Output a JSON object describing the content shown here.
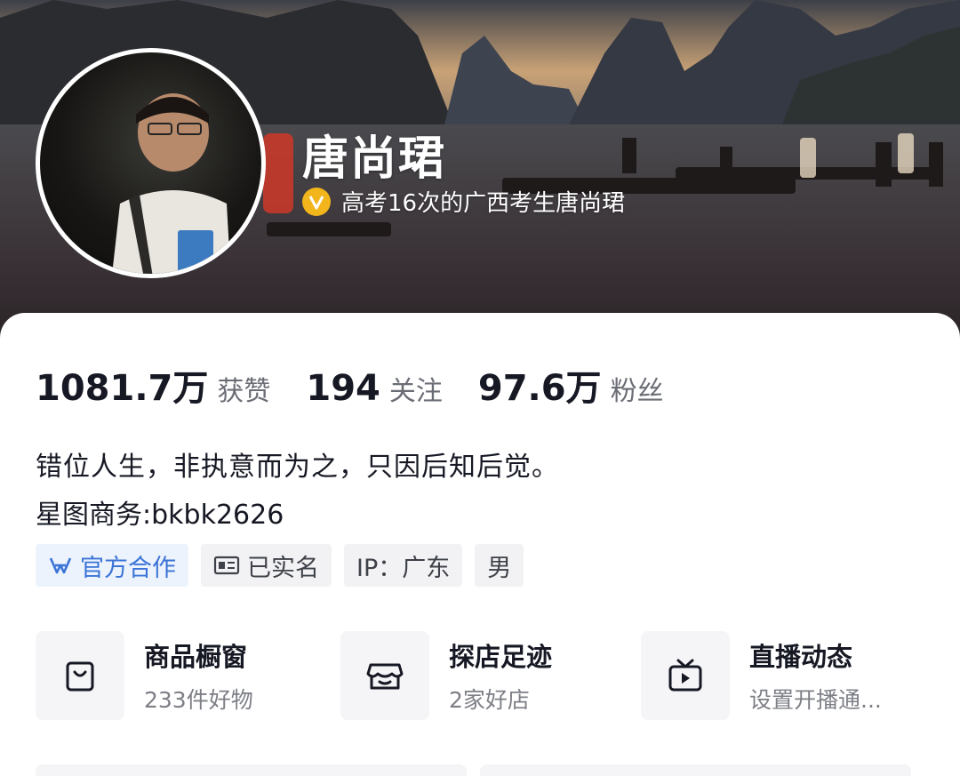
{
  "profile": {
    "nickname": "唐尚珺",
    "verify_text": "高考16次的广西考生唐尚珺",
    "verify_color": "#f2b51c"
  },
  "stats": [
    {
      "value": "1081.7万",
      "label": "获赞"
    },
    {
      "value": "194",
      "label": "关注"
    },
    {
      "value": "97.6万",
      "label": "粉丝"
    }
  ],
  "bio": {
    "line1": "错位人生，非执意而为之，只因后知后觉。",
    "line2": "星图商务:bkbk2626"
  },
  "tags": [
    {
      "label": "官方合作",
      "icon": "official-cooperation-icon",
      "color": "#3b74d6"
    },
    {
      "label": "已实名",
      "icon": "id-card-icon"
    },
    {
      "label": "IP：广东"
    },
    {
      "label": "男"
    }
  ],
  "services": [
    {
      "title": "商品橱窗",
      "subtitle": "233件好物",
      "icon": "shopping-bag-icon"
    },
    {
      "title": "探店足迹",
      "subtitle": "2家好店",
      "icon": "storefront-icon"
    },
    {
      "title": "直播动态",
      "subtitle": "设置开播通...",
      "icon": "tv-icon"
    }
  ]
}
